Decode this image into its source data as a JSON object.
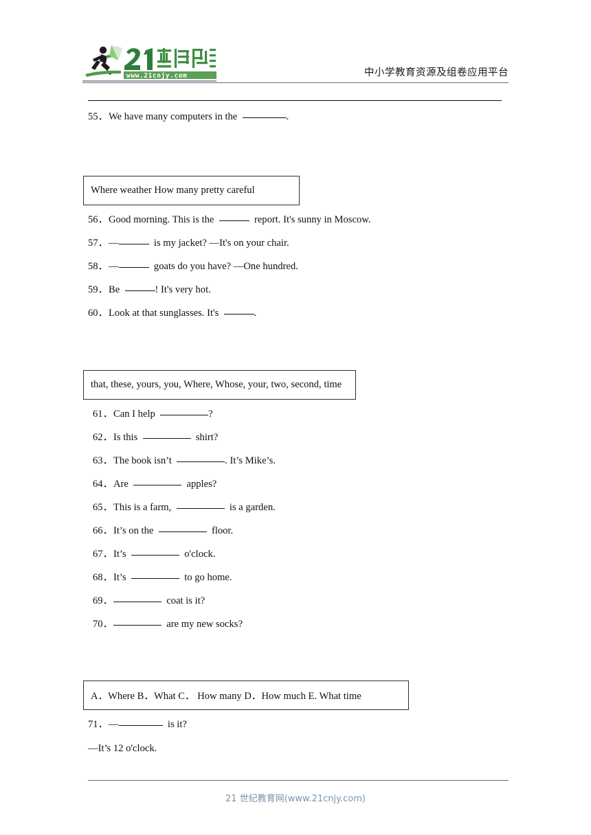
{
  "header": {
    "logo_title": "21世纪教育",
    "logo_url": "www.21cnjy.com",
    "tagline": "中小学教育资源及组卷应用平台",
    "logo_green": "#4e9b4a",
    "logo_dark_green": "#2f7d3d"
  },
  "questions_part_a": [
    {
      "number": "55．",
      "before": "We have many computers in the",
      "after": "."
    }
  ],
  "wordbank_1": {
    "text": "Where    weather    How many    pretty    careful",
    "words": [
      "Where",
      "weather",
      "How many",
      "pretty",
      "careful"
    ]
  },
  "questions_part_b": [
    {
      "number": "56．",
      "before": "Good morning. This is the",
      "after": "report. It's sunny in Moscow."
    },
    {
      "number": "57．",
      "before": "—",
      "after": "is my jacket? —It's on your chair."
    },
    {
      "number": "58．",
      "before": "—",
      "after": "goats do you have? —One hundred."
    },
    {
      "number": "59．",
      "before": "Be",
      "after": "! It's very hot."
    },
    {
      "number": "60．",
      "before": "Look at that sunglasses. It's",
      "after": "."
    }
  ],
  "wordbank_2": {
    "text": "that, these, yours, you, Where, Whose, your, two, second, time",
    "words": [
      "that",
      "these",
      "yours",
      "you",
      "Where",
      "Whose",
      "your",
      "two",
      "second",
      "time"
    ]
  },
  "questions_part_c": [
    {
      "number": "61．",
      "before": "Can I help",
      "after": "?"
    },
    {
      "number": "62．",
      "before": "Is this",
      "after": "shirt?"
    },
    {
      "number": "63．",
      "before": "The book isn’t",
      "after": ". It’s Mike’s."
    },
    {
      "number": "64．",
      "before": "Are",
      "after": "apples?"
    },
    {
      "number": "65．",
      "before": "This is a farm,",
      "after": "is a garden."
    },
    {
      "number": "66．",
      "before": "It’s on the",
      "after": "floor."
    },
    {
      "number": "67．",
      "before": "It’s",
      "after": "o'clock."
    },
    {
      "number": "68．",
      "before": "It’s",
      "after": "to go home."
    },
    {
      "number": "69．",
      "before": "",
      "after": "coat is it?"
    },
    {
      "number": "70．",
      "before": "",
      "after": "are my new socks?"
    }
  ],
  "options_box": {
    "text": "A．Where  B．What  C．  How many  D．How much  E. What time",
    "options": [
      {
        "letter": "A．",
        "label": "Where"
      },
      {
        "letter": "B．",
        "label": "What"
      },
      {
        "letter": "C．",
        "label": "How many"
      },
      {
        "letter": "D．",
        "label": "How much"
      },
      {
        "letter": "E.",
        "label": "What time"
      }
    ]
  },
  "questions_part_d": [
    {
      "number": "71．",
      "before": "—",
      "after": "is it?"
    }
  ],
  "answer_line": "—It’s 12 o'clock.",
  "footer": {
    "text": "21 世纪教育网(www.21cnjy.com)",
    "color": "#7b93ad"
  }
}
